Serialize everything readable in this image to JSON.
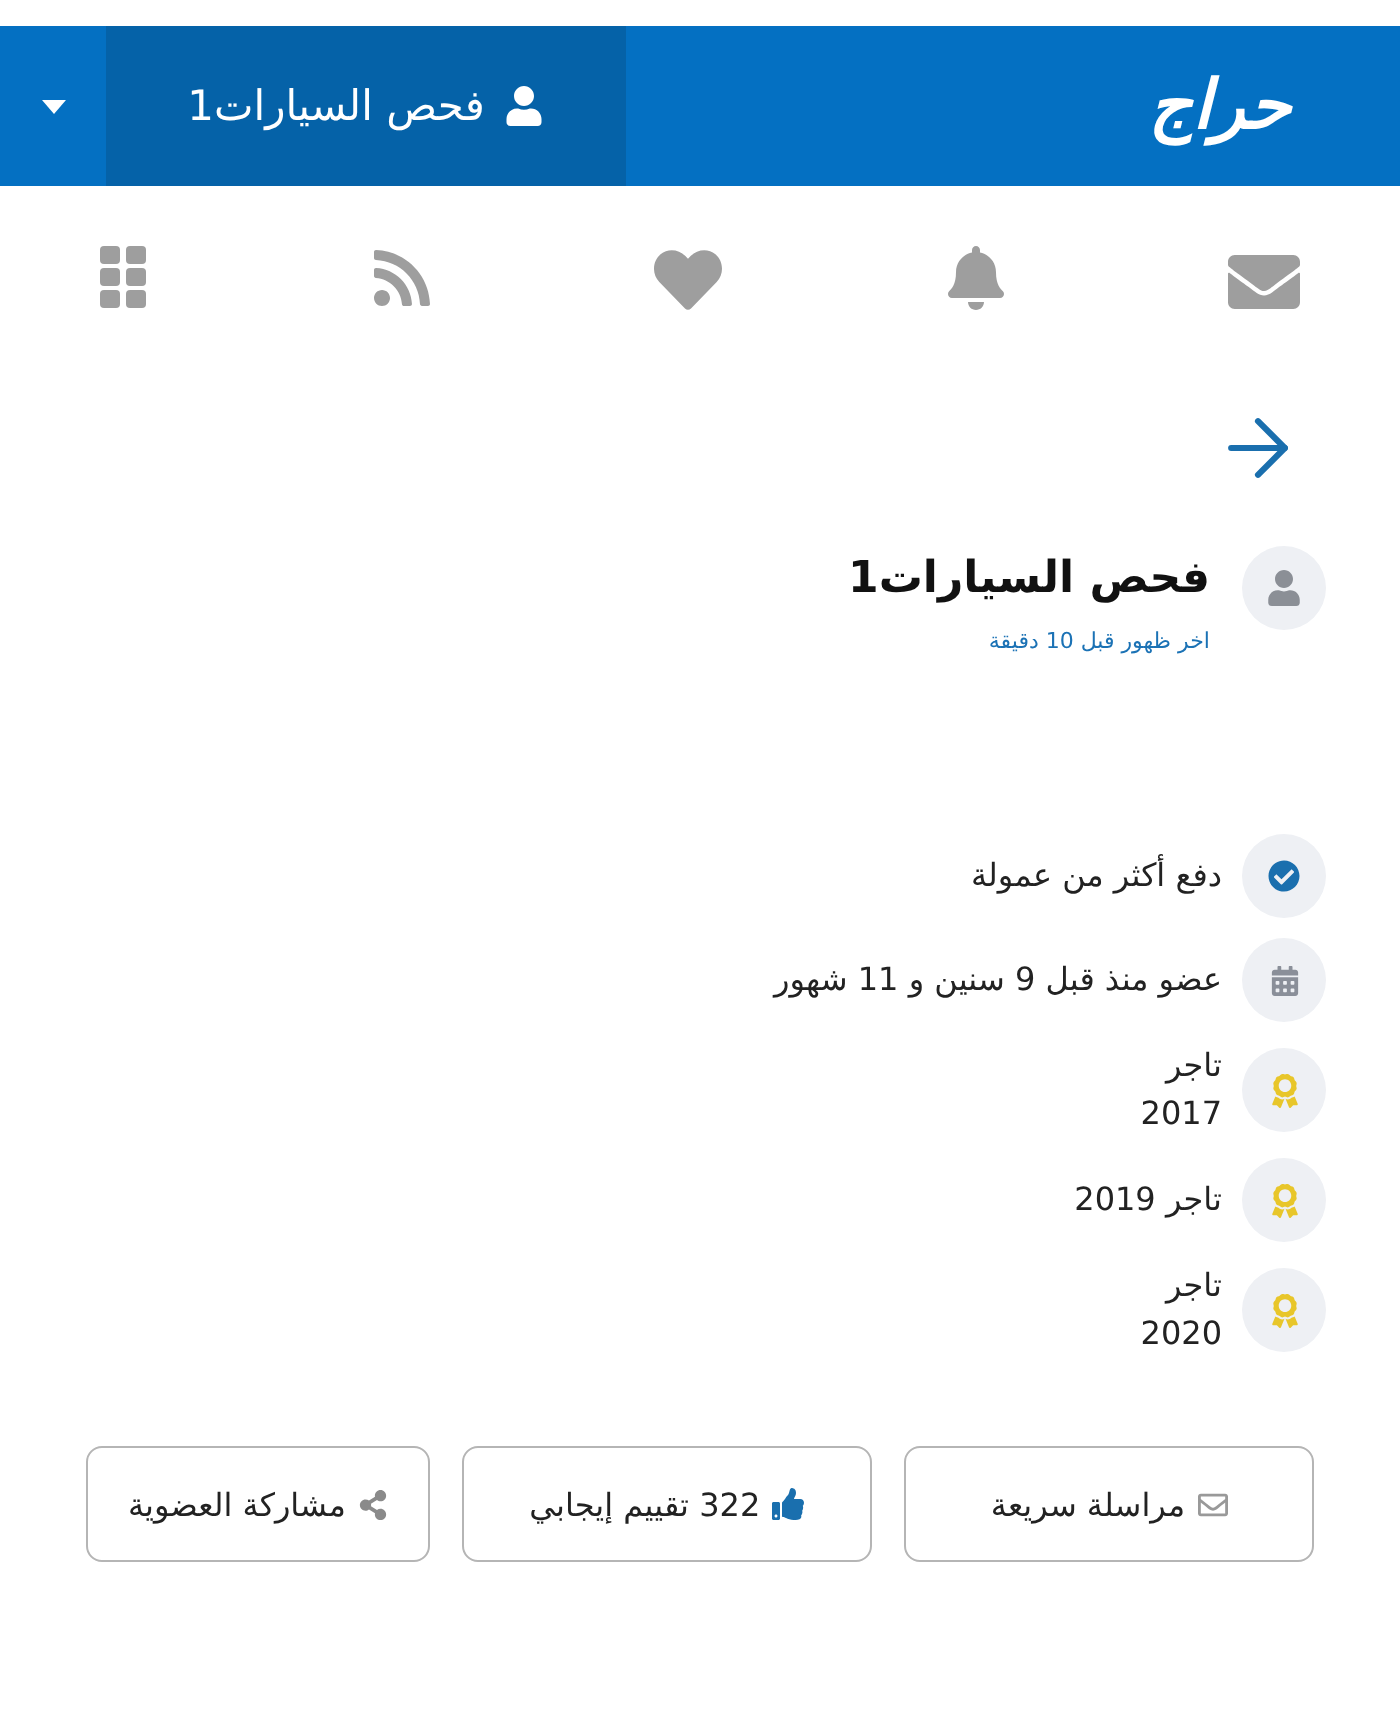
{
  "header": {
    "logo": "حراج",
    "account": {
      "name": "فحص السيارات1"
    }
  },
  "profile": {
    "name": "فحص السيارات1",
    "last_seen": "اخر ظهور قبل 10 دقيقة"
  },
  "details": [
    {
      "kind": "verified",
      "text": "دفع أكثر من عمولة"
    },
    {
      "kind": "calendar",
      "text": "عضو منذ قبل 9 سنين و 11 شهور"
    },
    {
      "kind": "award",
      "text": "تاجر\n2017"
    },
    {
      "kind": "award",
      "text": "تاجر 2019"
    },
    {
      "kind": "award",
      "text": "تاجر\n2020"
    }
  ],
  "actions": [
    {
      "kind": "message",
      "label": "مراسلة سريعة"
    },
    {
      "kind": "rating",
      "label": "322 تقييم إيجابي"
    },
    {
      "kind": "share",
      "label": "مشاركة العضوية"
    }
  ]
}
